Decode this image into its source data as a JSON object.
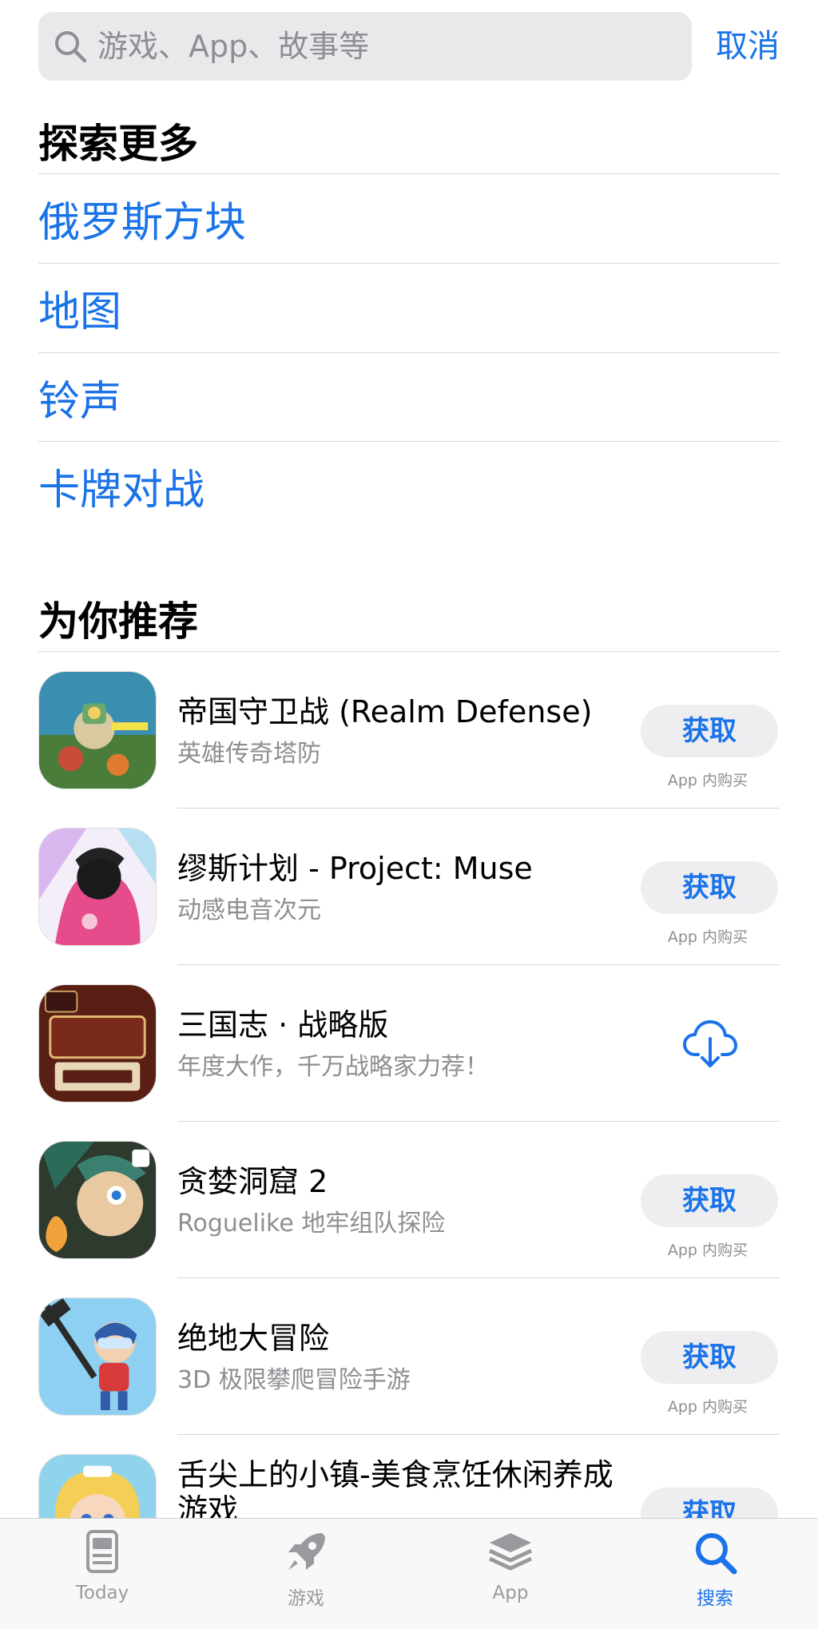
{
  "search": {
    "placeholder": "游戏、App、故事等",
    "cancel_label": "取消"
  },
  "explore": {
    "title": "探索更多",
    "items": [
      "俄罗斯方块",
      "地图",
      "铃声",
      "卡牌对战"
    ]
  },
  "recommend": {
    "title": "为你推荐",
    "apps": [
      {
        "name": "帝国守卫战 (Realm Defense)",
        "subtitle": "英雄传奇塔防",
        "action": "获取",
        "note": "App 内购买"
      },
      {
        "name": "缪斯计划 - Project: Muse",
        "subtitle": "动感电音次元",
        "action": "获取",
        "note": "App 内购买"
      },
      {
        "name": "三国志 · 战略版",
        "subtitle": "年度大作，千万战略家力荐！",
        "action": "download-cloud-icon"
      },
      {
        "name": "贪婪洞窟 2",
        "subtitle": "Roguelike 地牢组队探险",
        "action": "获取",
        "note": "App 内购买"
      },
      {
        "name": "绝地大冒险",
        "subtitle": "3D 极限攀爬冒险手游",
        "action": "获取",
        "note": "App 内购买"
      },
      {
        "name": "舌尖上的小镇-美食烹饪休闲养成游戏",
        "action": "获取"
      }
    ]
  },
  "tabs": [
    {
      "label": "Today",
      "icon": "today-icon"
    },
    {
      "label": "游戏",
      "icon": "rocket-icon"
    },
    {
      "label": "App",
      "icon": "app-stack-icon"
    },
    {
      "label": "搜索",
      "icon": "search-icon",
      "active": true
    }
  ],
  "colors": {
    "accent": "#1a73e8",
    "secondary_text": "#8e8e93",
    "search_bg": "#e9e9eb",
    "button_bg": "#eeeef0",
    "tab_bar_bg": "#f8f8f8"
  }
}
